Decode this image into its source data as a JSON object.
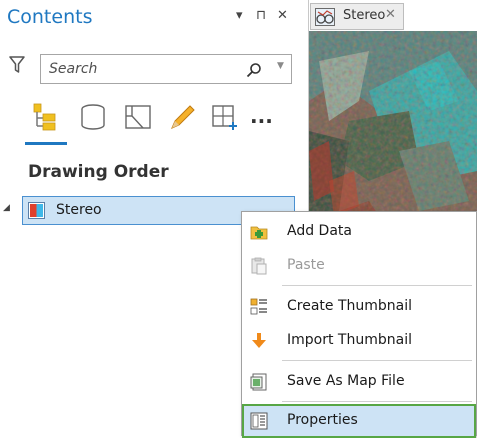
{
  "contents_pane": {
    "title": "Contents",
    "controls": {
      "menu": "▾",
      "pin": "⊓",
      "close": "✕"
    },
    "search": {
      "placeholder": "Search",
      "value": ""
    },
    "view_tabs": [
      {
        "icon": "list-by-drawing-order-icon",
        "selected": true
      },
      {
        "icon": "list-by-source-icon"
      },
      {
        "icon": "list-by-selection-icon"
      },
      {
        "icon": "list-by-editing-icon"
      },
      {
        "icon": "list-by-snapping-icon"
      }
    ],
    "more": "...",
    "section_header": "Drawing Order",
    "layers": [
      {
        "name": "Stereo",
        "expanded": false,
        "selected": true
      }
    ]
  },
  "map_tab": {
    "label": "Stereo",
    "close": "✕",
    "icon": "stereo-map-icon"
  },
  "context_menu": {
    "items": [
      {
        "label": "Add Data",
        "icon": "add-data-icon",
        "enabled": true
      },
      {
        "label": "Paste",
        "icon": "paste-icon",
        "enabled": false
      },
      {
        "label": "Create Thumbnail",
        "icon": "create-thumbnail-icon",
        "enabled": true
      },
      {
        "label": "Import Thumbnail",
        "icon": "import-thumbnail-icon",
        "enabled": true
      },
      {
        "label": "Save As Map File",
        "icon": "save-map-file-icon",
        "enabled": true
      },
      {
        "label": "Properties",
        "icon": "properties-icon",
        "enabled": true,
        "highlighted": true
      }
    ]
  },
  "colors": {
    "accent": "#1f78c1",
    "selection_fill": "#cde3f5",
    "selection_border": "#4a90d0",
    "highlight_border": "#57a645"
  }
}
